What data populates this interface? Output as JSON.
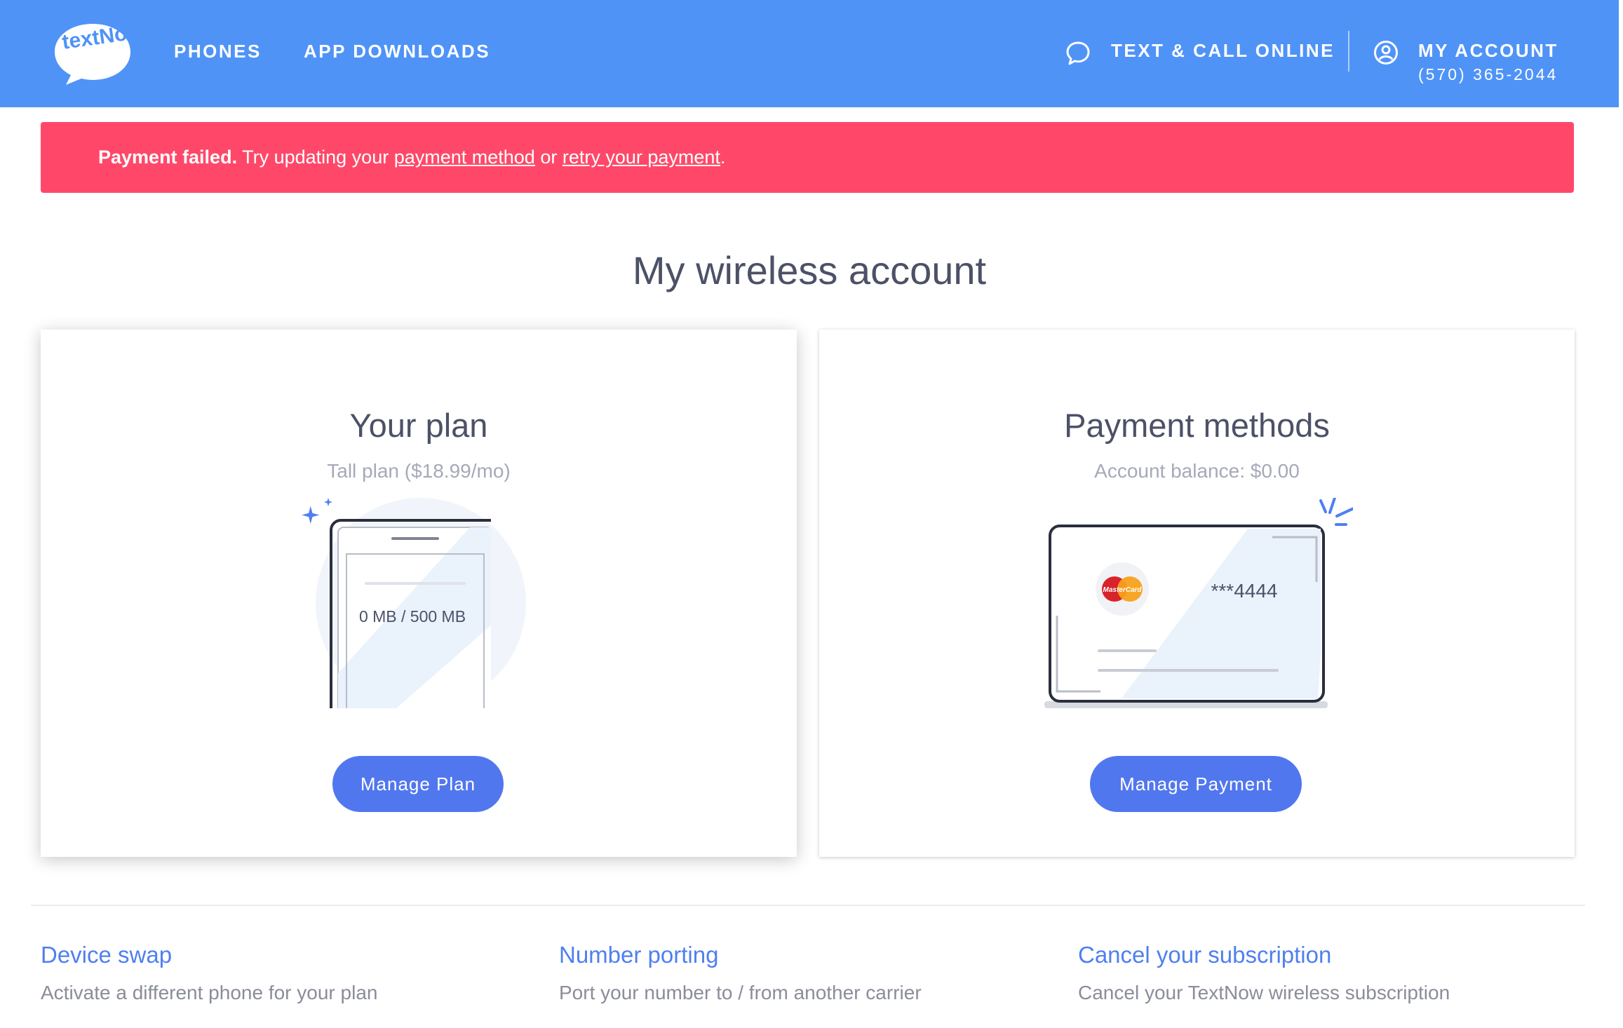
{
  "header": {
    "logo_text": "textNow",
    "nav": {
      "phones": "PHONES",
      "app_downloads": "APP DOWNLOADS"
    },
    "text_call_online": "TEXT & CALL ONLINE",
    "account": {
      "label": "MY ACCOUNT",
      "phone": "(570) 365-2044"
    }
  },
  "alert": {
    "bold": "Payment failed.",
    "text_before": " Try updating your ",
    "link_payment_method": "payment method",
    "text_middle": " or ",
    "link_retry": "retry your payment",
    "text_after": "."
  },
  "page_title": "My wireless account",
  "plan_card": {
    "title": "Your plan",
    "subtitle": "Tall plan ($18.99/mo)",
    "data_usage": "0 MB / 500 MB",
    "button": "Manage Plan"
  },
  "payment_card": {
    "title": "Payment methods",
    "subtitle": "Account balance: $0.00",
    "card_brand": "MasterCard",
    "card_number": "***4444",
    "button": "Manage Payment"
  },
  "links": [
    {
      "title": "Device swap",
      "desc": "Activate a different phone for your plan"
    },
    {
      "title": "Number porting",
      "desc": "Port your number to / from another carrier"
    },
    {
      "title": "Cancel your subscription",
      "desc": "Cancel your TextNow wireless subscription"
    }
  ],
  "colors": {
    "header": "#4f93f7",
    "alert": "#ff4869",
    "button": "#5177ef",
    "link": "#4f7ff0"
  },
  "icons": [
    "textnow-logo",
    "chat-bubble-icon",
    "account-circle-icon",
    "sparkle-icon",
    "phone-illustration",
    "credit-card-illustration",
    "mastercard-logo"
  ]
}
